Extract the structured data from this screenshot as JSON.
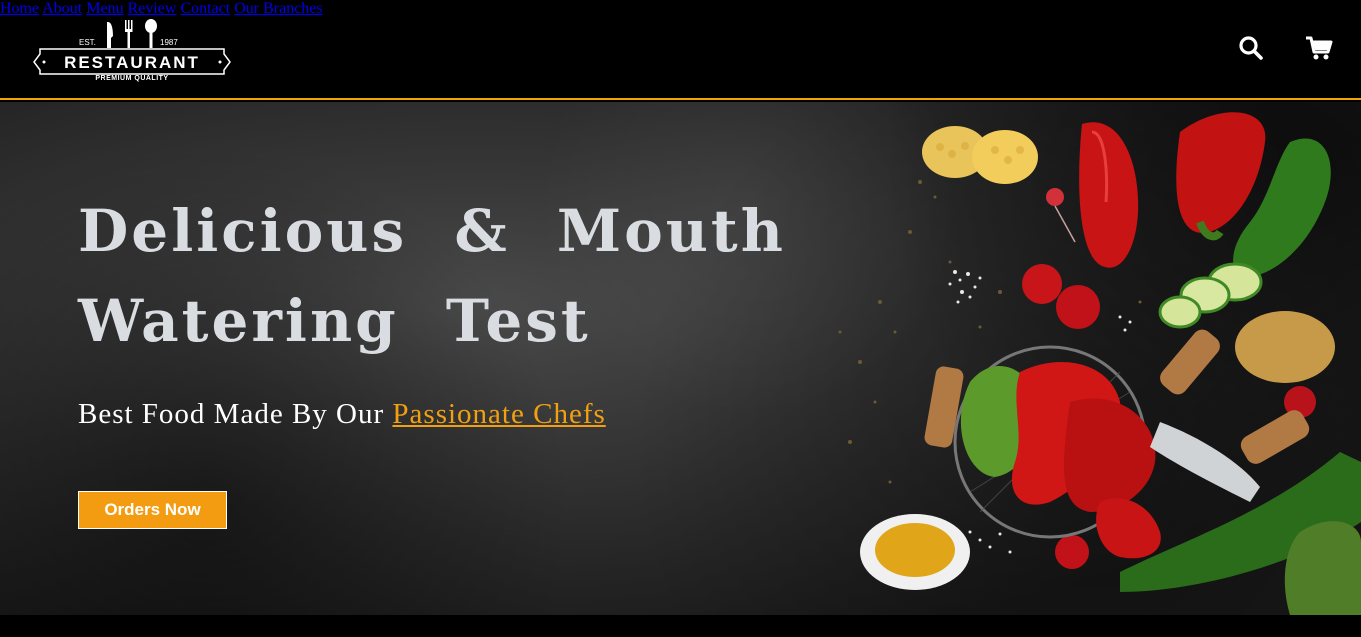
{
  "logo": {
    "est": "EST.",
    "year": "1987",
    "name": "RESTAURANT",
    "tagline": "PREMIUM QUALITY"
  },
  "nav": {
    "items": [
      {
        "label": "Home"
      },
      {
        "label": "About"
      },
      {
        "label": "Menu"
      },
      {
        "label": "Review"
      },
      {
        "label": "Contact"
      },
      {
        "label": "Our Branches"
      }
    ]
  },
  "icons": {
    "search": "search-icon",
    "cart": "cart-icon"
  },
  "hero": {
    "title_line1": "Delicious & Mouth",
    "title_line2": "Watering Test",
    "subtitle_prefix": "Best Food Made By Our ",
    "subtitle_highlight": "Passionate Chefs",
    "cta_label": "Orders Now"
  },
  "colors": {
    "accent": "#f39c12",
    "header_bg": "#000000",
    "title_text": "#d9dce0"
  }
}
